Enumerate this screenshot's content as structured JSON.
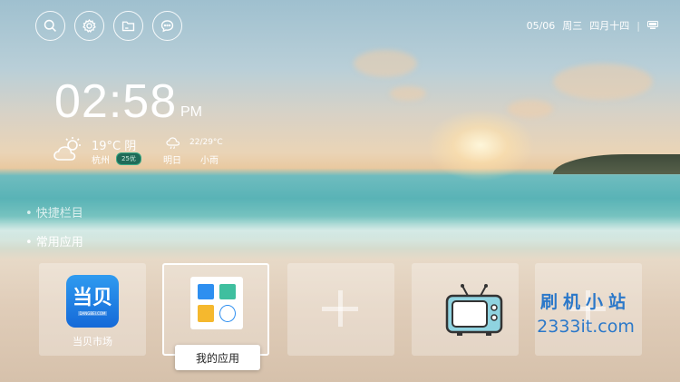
{
  "top_icons": [
    {
      "name": "search-icon"
    },
    {
      "name": "settings-icon"
    },
    {
      "name": "folder-icon"
    },
    {
      "name": "message-icon"
    }
  ],
  "status": {
    "date": "05/06",
    "weekday": "周三",
    "lunar": "四月十四",
    "separator": "|"
  },
  "clock": {
    "time": "02:58",
    "ampm": "PM"
  },
  "weather": {
    "today_temp": "19°C 阴",
    "city": "杭州",
    "aqi": "25优",
    "tomorrow_temp": "22/29°C",
    "tomorrow_label": "明日",
    "tomorrow_weather": "小雨"
  },
  "menu": {
    "items": [
      {
        "label": "• 快捷栏目"
      },
      {
        "label": "• 常用应用"
      }
    ]
  },
  "tiles": [
    {
      "name": "dangbei-market",
      "logo_text": "当贝",
      "logo_small": "DANGBEI.COM",
      "label": "当贝市场"
    },
    {
      "name": "my-apps",
      "label": "我的应用",
      "selected": true
    },
    {
      "name": "add-app"
    },
    {
      "name": "tv-app"
    },
    {
      "name": "add-app-2"
    }
  ],
  "watermark": {
    "line1": "刷机小站",
    "line2": "2333it.com"
  },
  "colors": {
    "accent_blue": "#2b78c9",
    "aqi_green": "#1f6b58"
  }
}
